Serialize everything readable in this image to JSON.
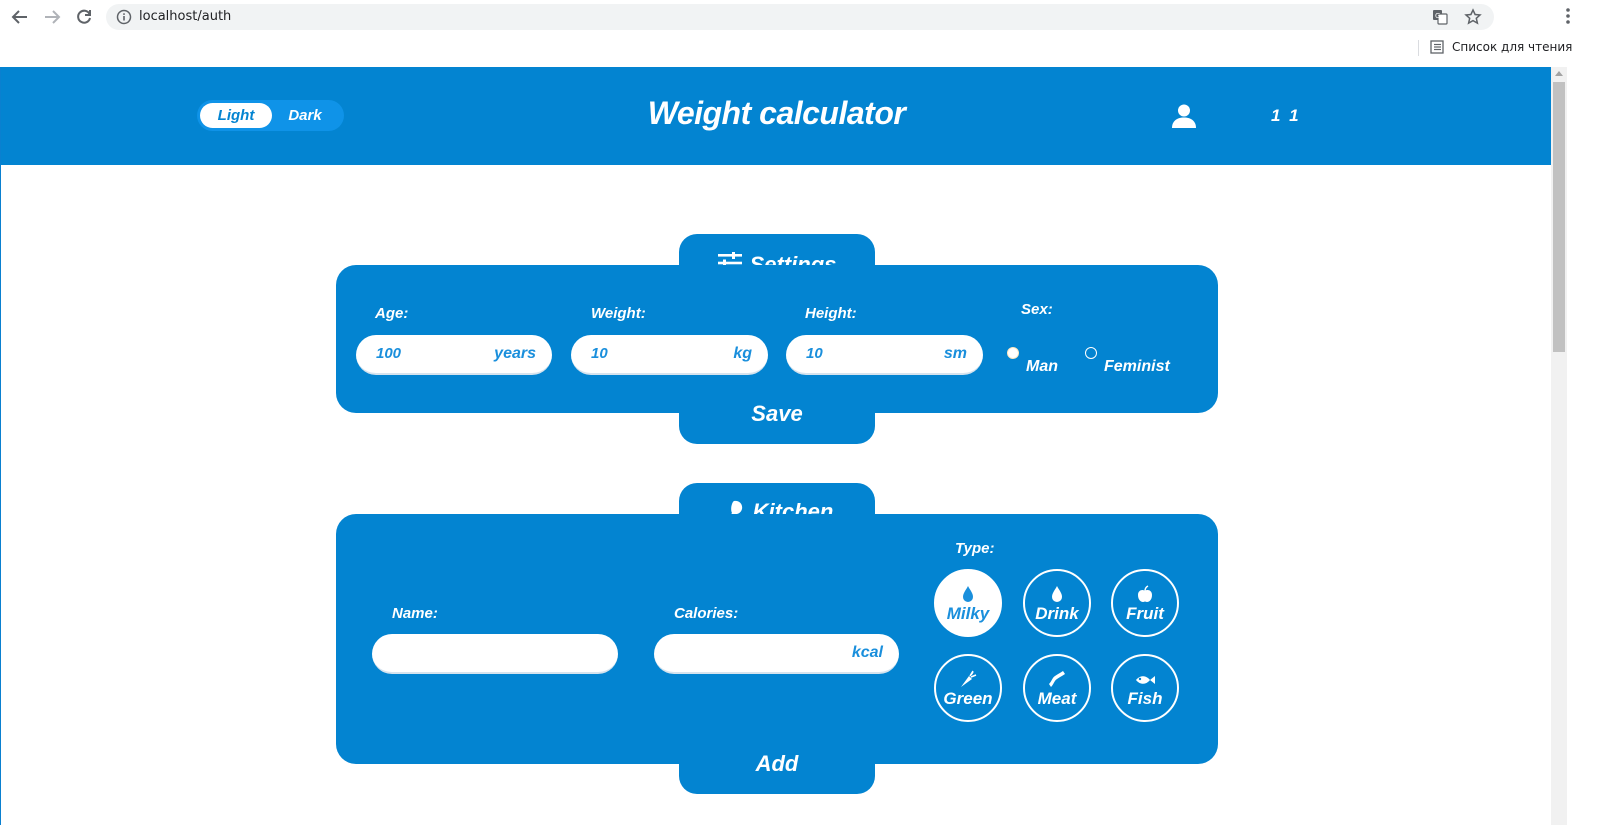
{
  "browser": {
    "url": "localhost/auth",
    "reading_list": "Список для чтения"
  },
  "header": {
    "theme_light": "Light",
    "theme_dark": "Dark",
    "title": "Weight calculator",
    "user_name": "1 1"
  },
  "settings": {
    "title": "Settings",
    "age_label": "Age:",
    "age_value": "100",
    "age_unit": "years",
    "weight_label": "Weight:",
    "weight_value": "10",
    "weight_unit": "kg",
    "height_label": "Height:",
    "height_value": "10",
    "height_unit": "sm",
    "sex_label": "Sex:",
    "sex_options": [
      "Man",
      "Feminist"
    ],
    "sex_selected": "Man",
    "save_label": "Save"
  },
  "kitchen": {
    "title": "Kitchen",
    "name_label": "Name:",
    "name_value": "",
    "calories_label": "Calories:",
    "calories_value": "",
    "calories_unit": "kcal",
    "type_label": "Type:",
    "types": [
      "Milky",
      "Drink",
      "Fruit",
      "Green",
      "Meat",
      "Fish"
    ],
    "type_selected": "Milky",
    "add_label": "Add"
  },
  "colors": {
    "primary": "#0384d1",
    "toggle_bg": "#0f93e8",
    "accent_text": "#1a8fdc",
    "white": "#ffffff"
  }
}
